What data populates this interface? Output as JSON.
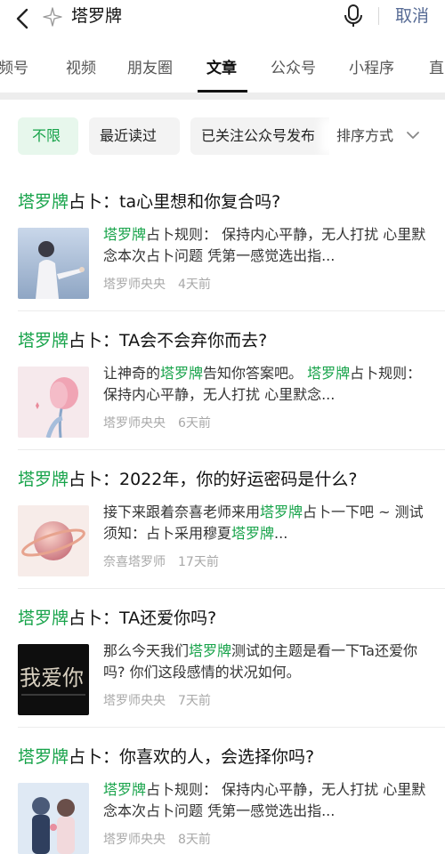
{
  "search": {
    "query": "塔罗牌",
    "cancel_label": "取消"
  },
  "tabs": [
    {
      "label": "频号"
    },
    {
      "label": "视频"
    },
    {
      "label": "朋友圈"
    },
    {
      "label": "文章"
    },
    {
      "label": "公众号"
    },
    {
      "label": "小程序"
    },
    {
      "label": "直"
    }
  ],
  "filters": {
    "chips": [
      {
        "label": "不限"
      },
      {
        "label": "最近读过"
      },
      {
        "label": "已关注公众号发布"
      }
    ],
    "sort_label": "排序方式"
  },
  "highlight_color": "#17a34a",
  "results": [
    {
      "title_hl": "塔罗牌",
      "title_rest": "占卜：ta心里想和你复合吗?",
      "snippet": [
        {
          "t": "塔罗牌",
          "hl": true
        },
        {
          "t": "占卜规则： 保持内心平静，无人打扰 心里默念本次占卜问题 凭第一感觉选出指..."
        }
      ],
      "author": "塔罗师央央",
      "time": "4天前"
    },
    {
      "title_hl": "塔罗牌",
      "title_rest": "占卜：TA会不会弃你而去?",
      "snippet": [
        {
          "t": "让神奇的"
        },
        {
          "t": "塔罗牌",
          "hl": true
        },
        {
          "t": "告知你答案吧。 "
        },
        {
          "t": "塔罗牌",
          "hl": true
        },
        {
          "t": "占卜规则： 保持内心平静，无人打扰 心里默念..."
        }
      ],
      "author": "塔罗师央央",
      "time": "6天前"
    },
    {
      "title_hl": "塔罗牌",
      "title_rest": "占卜：2022年，你的好运密码是什么?",
      "snippet": [
        {
          "t": "接下来跟着奈喜老师来用"
        },
        {
          "t": "塔罗牌",
          "hl": true
        },
        {
          "t": "占卜一下吧 ~ 测试须知：占卜采用穆夏"
        },
        {
          "t": "塔罗牌",
          "hl": true
        },
        {
          "t": "..."
        }
      ],
      "author": "奈喜塔罗师",
      "time": "17天前"
    },
    {
      "title_hl": "塔罗牌",
      "title_rest": "占卜：TA还爱你吗?",
      "snippet": [
        {
          "t": "那么今天我们"
        },
        {
          "t": "塔罗牌",
          "hl": true
        },
        {
          "t": "测试的主题是看一下Ta还爱你吗? 你们这段感情的状况如何。"
        }
      ],
      "author": "塔罗师央央",
      "time": "7天前"
    },
    {
      "title_hl": "塔罗牌",
      "title_rest": "占卜：你喜欢的人，会选择你吗?",
      "snippet": [
        {
          "t": "塔罗牌",
          "hl": true
        },
        {
          "t": "占卜规则： 保持内心平静，无人打扰 心里默念本次占卜问题 凭第一感觉选出指..."
        }
      ],
      "author": "塔罗师央央",
      "time": "8天前"
    }
  ],
  "thumbnails": [
    {
      "icon": "couple-sky-image"
    },
    {
      "icon": "pink-tulip-image"
    },
    {
      "icon": "planet-ring-image"
    },
    {
      "icon": "dark-text-image",
      "text": "我爱你"
    },
    {
      "icon": "anime-couple-image"
    }
  ]
}
